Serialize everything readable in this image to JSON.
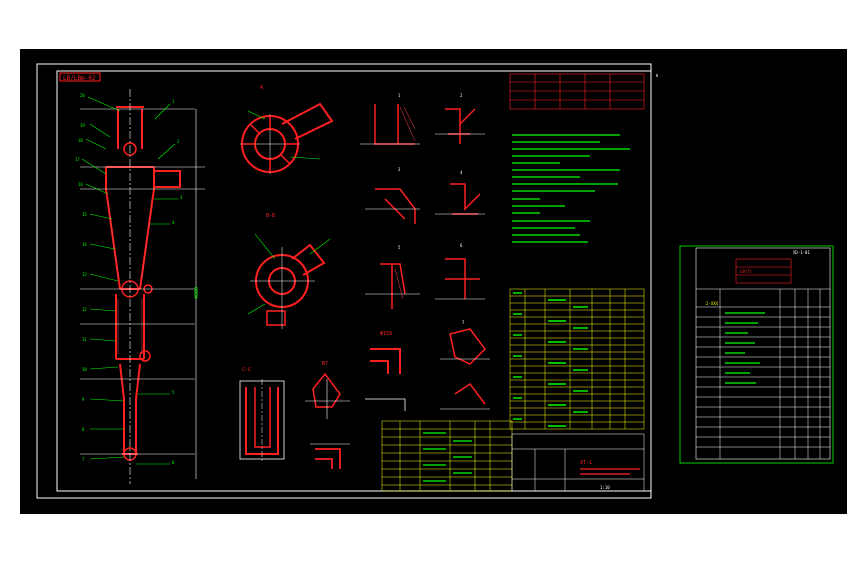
{
  "colors": {
    "background": "#000000",
    "frame": "#ffffff",
    "part": "#ff2020",
    "dim": "#00ff00",
    "table": "#ffff00",
    "note": "#00ff00",
    "tag": "#ff2020"
  },
  "sheet_a": {
    "drawing_no_tag": "LB/LBm-02",
    "dim_vertical": "4800",
    "section_labels": [
      "A",
      "B-B",
      "C-C",
      "A-A",
      "B7",
      "1",
      "2",
      "3",
      "4",
      "5",
      "6",
      "7"
    ],
    "flange_label": "Φ159",
    "title_block_name": "XT-1",
    "title_block_scale": "1:10"
  },
  "sheet_b": {
    "title_no": "XD-1-01",
    "title_sub": "LB(T)",
    "block_label": "2-XXX"
  }
}
